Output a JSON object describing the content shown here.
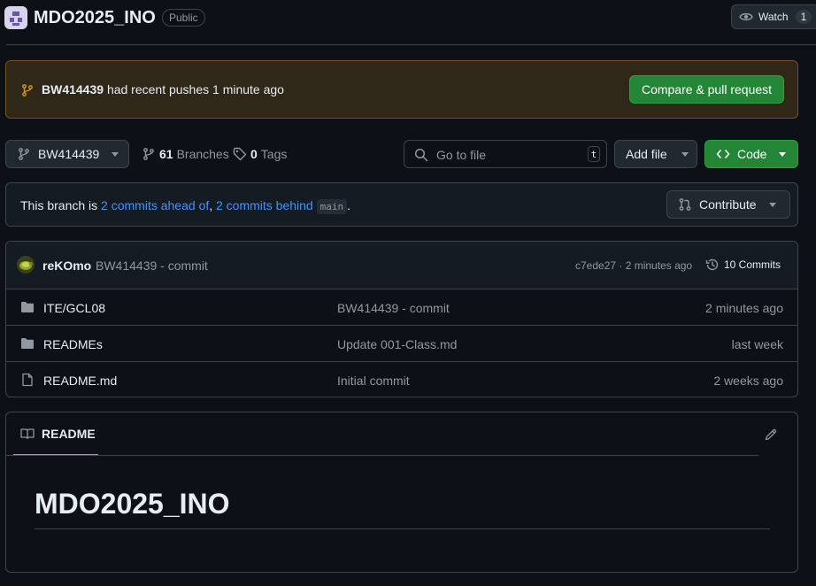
{
  "repo": {
    "name": "MDO2025_INO",
    "visibility": "Public",
    "watch_label": "Watch",
    "watch_count": "1"
  },
  "banner": {
    "branch": "BW414439",
    "message": "had recent pushes 1 minute ago",
    "compare_button": "Compare & pull request"
  },
  "toolbar": {
    "branch": "BW414439",
    "branches_count": "61",
    "branches_label": "Branches",
    "tags_count": "0",
    "tags_label": "Tags",
    "search_placeholder": "Go to file",
    "search_shortcut": "t",
    "add_file": "Add file",
    "code": "Code"
  },
  "status": {
    "prefix": "This branch is",
    "ahead": "2 commits ahead of",
    "separator": ",",
    "behind": "2 commits behind",
    "base": "main",
    "suffix": ".",
    "contribute": "Contribute"
  },
  "latest_commit": {
    "author": "reKOmo",
    "message": "BW414439 - commit",
    "hash_time": "c7ede27 · 2 minutes ago",
    "commits_label": "10 Commits"
  },
  "files": [
    {
      "name": "ITE/GCL08",
      "type": "folder",
      "message": "BW414439 - commit",
      "time": "2 minutes ago"
    },
    {
      "name": "READMEs",
      "type": "folder",
      "message": "Update 001-Class.md",
      "time": "last week"
    },
    {
      "name": "README.md",
      "type": "file",
      "message": "Initial commit",
      "time": "2 weeks ago"
    }
  ],
  "readme": {
    "tab_label": "README",
    "heading": "MDO2025_INO"
  },
  "colors": {
    "background": "#0d1117",
    "border": "#3d444d",
    "accent_green": "#238636",
    "link_blue": "#4493f8",
    "banner_bg": "#2f2717",
    "banner_border": "#6f5124",
    "tab_underline": "#f78166"
  }
}
